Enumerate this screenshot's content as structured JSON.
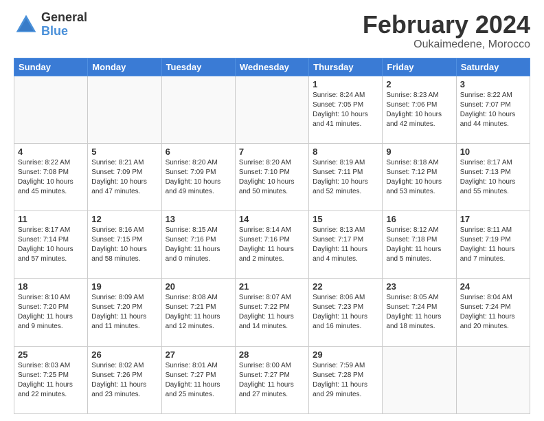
{
  "logo": {
    "general": "General",
    "blue": "Blue"
  },
  "title": "February 2024",
  "location": "Oukaimedene, Morocco",
  "days_of_week": [
    "Sunday",
    "Monday",
    "Tuesday",
    "Wednesday",
    "Thursday",
    "Friday",
    "Saturday"
  ],
  "weeks": [
    [
      {
        "day": "",
        "info": ""
      },
      {
        "day": "",
        "info": ""
      },
      {
        "day": "",
        "info": ""
      },
      {
        "day": "",
        "info": ""
      },
      {
        "day": "1",
        "info": "Sunrise: 8:24 AM\nSunset: 7:05 PM\nDaylight: 10 hours\nand 41 minutes."
      },
      {
        "day": "2",
        "info": "Sunrise: 8:23 AM\nSunset: 7:06 PM\nDaylight: 10 hours\nand 42 minutes."
      },
      {
        "day": "3",
        "info": "Sunrise: 8:22 AM\nSunset: 7:07 PM\nDaylight: 10 hours\nand 44 minutes."
      }
    ],
    [
      {
        "day": "4",
        "info": "Sunrise: 8:22 AM\nSunset: 7:08 PM\nDaylight: 10 hours\nand 45 minutes."
      },
      {
        "day": "5",
        "info": "Sunrise: 8:21 AM\nSunset: 7:09 PM\nDaylight: 10 hours\nand 47 minutes."
      },
      {
        "day": "6",
        "info": "Sunrise: 8:20 AM\nSunset: 7:09 PM\nDaylight: 10 hours\nand 49 minutes."
      },
      {
        "day": "7",
        "info": "Sunrise: 8:20 AM\nSunset: 7:10 PM\nDaylight: 10 hours\nand 50 minutes."
      },
      {
        "day": "8",
        "info": "Sunrise: 8:19 AM\nSunset: 7:11 PM\nDaylight: 10 hours\nand 52 minutes."
      },
      {
        "day": "9",
        "info": "Sunrise: 8:18 AM\nSunset: 7:12 PM\nDaylight: 10 hours\nand 53 minutes."
      },
      {
        "day": "10",
        "info": "Sunrise: 8:17 AM\nSunset: 7:13 PM\nDaylight: 10 hours\nand 55 minutes."
      }
    ],
    [
      {
        "day": "11",
        "info": "Sunrise: 8:17 AM\nSunset: 7:14 PM\nDaylight: 10 hours\nand 57 minutes."
      },
      {
        "day": "12",
        "info": "Sunrise: 8:16 AM\nSunset: 7:15 PM\nDaylight: 10 hours\nand 58 minutes."
      },
      {
        "day": "13",
        "info": "Sunrise: 8:15 AM\nSunset: 7:16 PM\nDaylight: 11 hours\nand 0 minutes."
      },
      {
        "day": "14",
        "info": "Sunrise: 8:14 AM\nSunset: 7:16 PM\nDaylight: 11 hours\nand 2 minutes."
      },
      {
        "day": "15",
        "info": "Sunrise: 8:13 AM\nSunset: 7:17 PM\nDaylight: 11 hours\nand 4 minutes."
      },
      {
        "day": "16",
        "info": "Sunrise: 8:12 AM\nSunset: 7:18 PM\nDaylight: 11 hours\nand 5 minutes."
      },
      {
        "day": "17",
        "info": "Sunrise: 8:11 AM\nSunset: 7:19 PM\nDaylight: 11 hours\nand 7 minutes."
      }
    ],
    [
      {
        "day": "18",
        "info": "Sunrise: 8:10 AM\nSunset: 7:20 PM\nDaylight: 11 hours\nand 9 minutes."
      },
      {
        "day": "19",
        "info": "Sunrise: 8:09 AM\nSunset: 7:20 PM\nDaylight: 11 hours\nand 11 minutes."
      },
      {
        "day": "20",
        "info": "Sunrise: 8:08 AM\nSunset: 7:21 PM\nDaylight: 11 hours\nand 12 minutes."
      },
      {
        "day": "21",
        "info": "Sunrise: 8:07 AM\nSunset: 7:22 PM\nDaylight: 11 hours\nand 14 minutes."
      },
      {
        "day": "22",
        "info": "Sunrise: 8:06 AM\nSunset: 7:23 PM\nDaylight: 11 hours\nand 16 minutes."
      },
      {
        "day": "23",
        "info": "Sunrise: 8:05 AM\nSunset: 7:24 PM\nDaylight: 11 hours\nand 18 minutes."
      },
      {
        "day": "24",
        "info": "Sunrise: 8:04 AM\nSunset: 7:24 PM\nDaylight: 11 hours\nand 20 minutes."
      }
    ],
    [
      {
        "day": "25",
        "info": "Sunrise: 8:03 AM\nSunset: 7:25 PM\nDaylight: 11 hours\nand 22 minutes."
      },
      {
        "day": "26",
        "info": "Sunrise: 8:02 AM\nSunset: 7:26 PM\nDaylight: 11 hours\nand 23 minutes."
      },
      {
        "day": "27",
        "info": "Sunrise: 8:01 AM\nSunset: 7:27 PM\nDaylight: 11 hours\nand 25 minutes."
      },
      {
        "day": "28",
        "info": "Sunrise: 8:00 AM\nSunset: 7:27 PM\nDaylight: 11 hours\nand 27 minutes."
      },
      {
        "day": "29",
        "info": "Sunrise: 7:59 AM\nSunset: 7:28 PM\nDaylight: 11 hours\nand 29 minutes."
      },
      {
        "day": "",
        "info": ""
      },
      {
        "day": "",
        "info": ""
      }
    ]
  ]
}
